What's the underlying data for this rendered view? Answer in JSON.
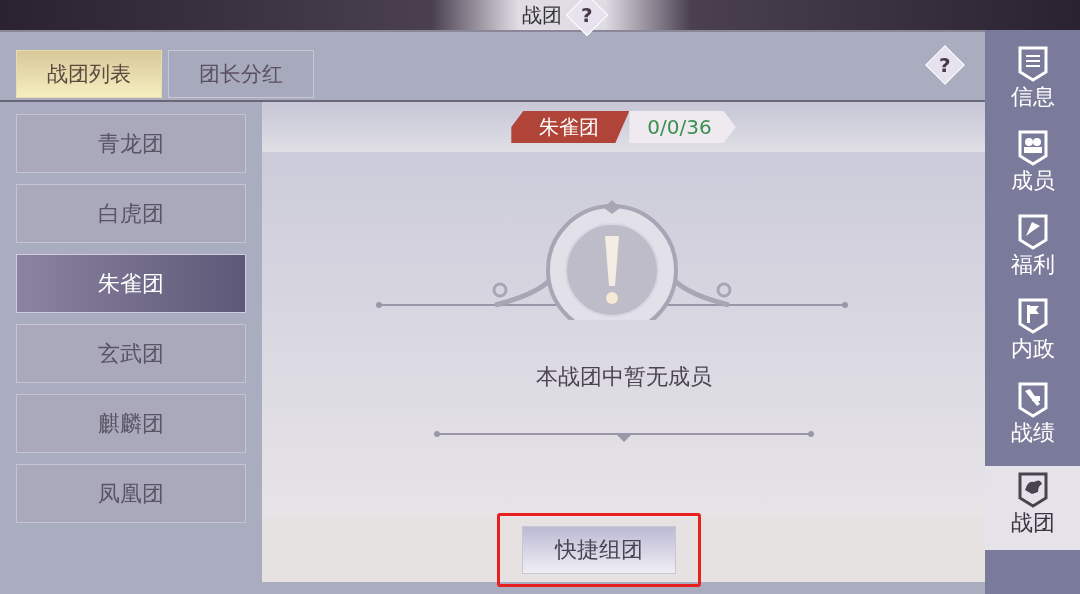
{
  "window": {
    "title": "战团",
    "help": "?"
  },
  "tabs": [
    {
      "label": "战团列表",
      "selected": true
    },
    {
      "label": "团长分红",
      "selected": false
    }
  ],
  "tab_help": "?",
  "legions": [
    {
      "label": "青龙团",
      "selected": false
    },
    {
      "label": "白虎团",
      "selected": false
    },
    {
      "label": "朱雀团",
      "selected": true
    },
    {
      "label": "玄武团",
      "selected": false
    },
    {
      "label": "麒麟团",
      "selected": false
    },
    {
      "label": "凤凰团",
      "selected": false
    }
  ],
  "header": {
    "name": "朱雀团",
    "count": "0/0/36"
  },
  "empty_message": "本战团中暂无成员",
  "quick_button": {
    "label": "快捷组团",
    "highlighted": true
  },
  "sidebar": [
    {
      "label": "信息",
      "kind": "notice",
      "selected": false
    },
    {
      "label": "成员",
      "kind": "members",
      "selected": false
    },
    {
      "label": "福利",
      "kind": "gift",
      "selected": false
    },
    {
      "label": "内政",
      "kind": "flag",
      "selected": false
    },
    {
      "label": "战绩",
      "kind": "hammer",
      "selected": false
    },
    {
      "label": "战团",
      "kind": "beast",
      "selected": true
    }
  ]
}
